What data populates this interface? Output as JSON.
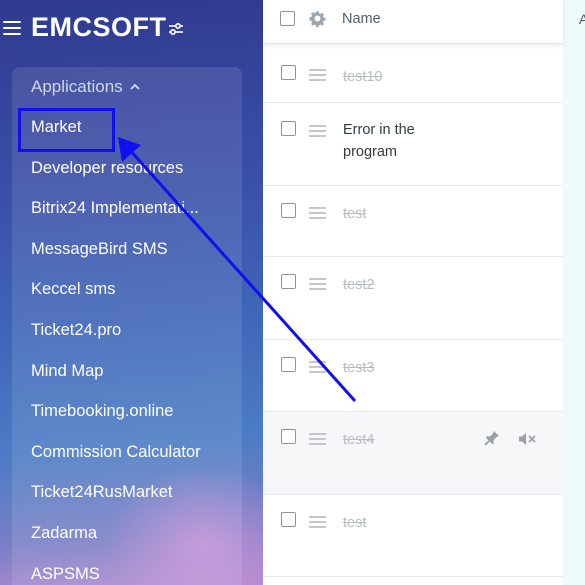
{
  "sidebar": {
    "brand": "EMCSOFT",
    "section_label": "Applications",
    "items": [
      {
        "label": "Market"
      },
      {
        "label": "Developer resources"
      },
      {
        "label": "Bitrix24 Implementati..."
      },
      {
        "label": "MessageBird SMS"
      },
      {
        "label": "Keccel sms"
      },
      {
        "label": "Ticket24.pro"
      },
      {
        "label": "Mind Map"
      },
      {
        "label": "Timebooking.online"
      },
      {
        "label": "Commission Calculator"
      },
      {
        "label": "Ticket24RusMarket"
      },
      {
        "label": "Zadarma"
      },
      {
        "label": "ASPSMS"
      }
    ]
  },
  "table": {
    "header_name": "Name",
    "header_next_col": "A",
    "rows": [
      {
        "title": "test10",
        "status": "done"
      },
      {
        "title": "Error in the program",
        "status": "active"
      },
      {
        "title": "test",
        "status": "done"
      },
      {
        "title": "test2",
        "status": "done"
      },
      {
        "title": "test3",
        "status": "done"
      },
      {
        "title": "test4",
        "status": "done"
      },
      {
        "title": "test",
        "status": "done"
      }
    ]
  },
  "annotation": {
    "highlight_color": "#1010ee"
  },
  "icons": {
    "menu": "hamburger-icon",
    "settings": "sliders-icon",
    "collapse": "chevron-up-icon",
    "gear": "gear-icon",
    "drag": "drag-handle-icon",
    "pin": "pin-icon",
    "mute": "mute-icon"
  }
}
